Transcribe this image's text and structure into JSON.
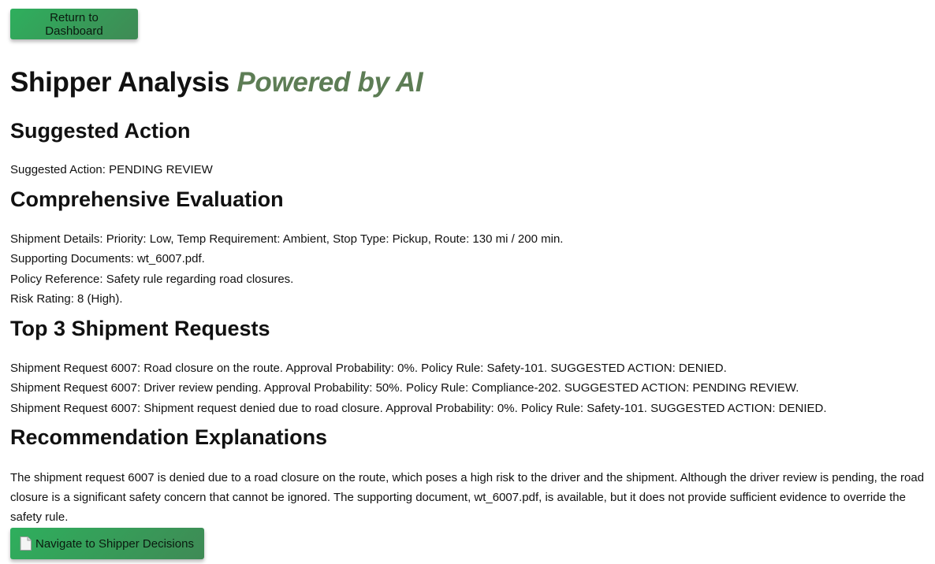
{
  "buttons": {
    "return": "Return to Dashboard",
    "navigate": "Navigate to Shipper Decisions",
    "navigate_icon": "document-icon"
  },
  "title": {
    "main": "Shipper Analysis",
    "powered": "Powered by AI"
  },
  "suggested_action": {
    "heading": "Suggested Action",
    "text": "Suggested Action: PENDING REVIEW"
  },
  "evaluation": {
    "heading": "Comprehensive Evaluation",
    "lines": [
      "Shipment Details: Priority: Low, Temp Requirement: Ambient, Stop Type: Pickup, Route: 130 mi / 200 min.",
      "Supporting Documents: wt_6007.pdf.",
      "Policy Reference: Safety rule regarding road closures.",
      "Risk Rating: 8 (High)."
    ]
  },
  "top_requests": {
    "heading": "Top 3 Shipment Requests",
    "items": [
      "Shipment Request 6007: Road closure on the route. Approval Probability: 0%. Policy Rule: Safety-101. SUGGESTED ACTION: DENIED.",
      "Shipment Request 6007: Driver review pending. Approval Probability: 50%. Policy Rule: Compliance-202. SUGGESTED ACTION: PENDING REVIEW.",
      "Shipment Request 6007: Shipment request denied due to road closure. Approval Probability: 0%. Policy Rule: Safety-101. SUGGESTED ACTION: DENIED."
    ]
  },
  "explanations": {
    "heading": "Recommendation Explanations",
    "text": "The shipment request 6007 is denied due to a road closure on the route, which poses a high risk to the driver and the shipment. Although the driver review is pending, the road closure is a significant safety concern that cannot be ignored. The supporting document, wt_6007.pdf, is available, but it does not provide sufficient evidence to override the safety rule."
  },
  "colors": {
    "button_start": "#2eaf5d",
    "button_end": "#3f8a55",
    "powered_text": "#5d7d55"
  }
}
